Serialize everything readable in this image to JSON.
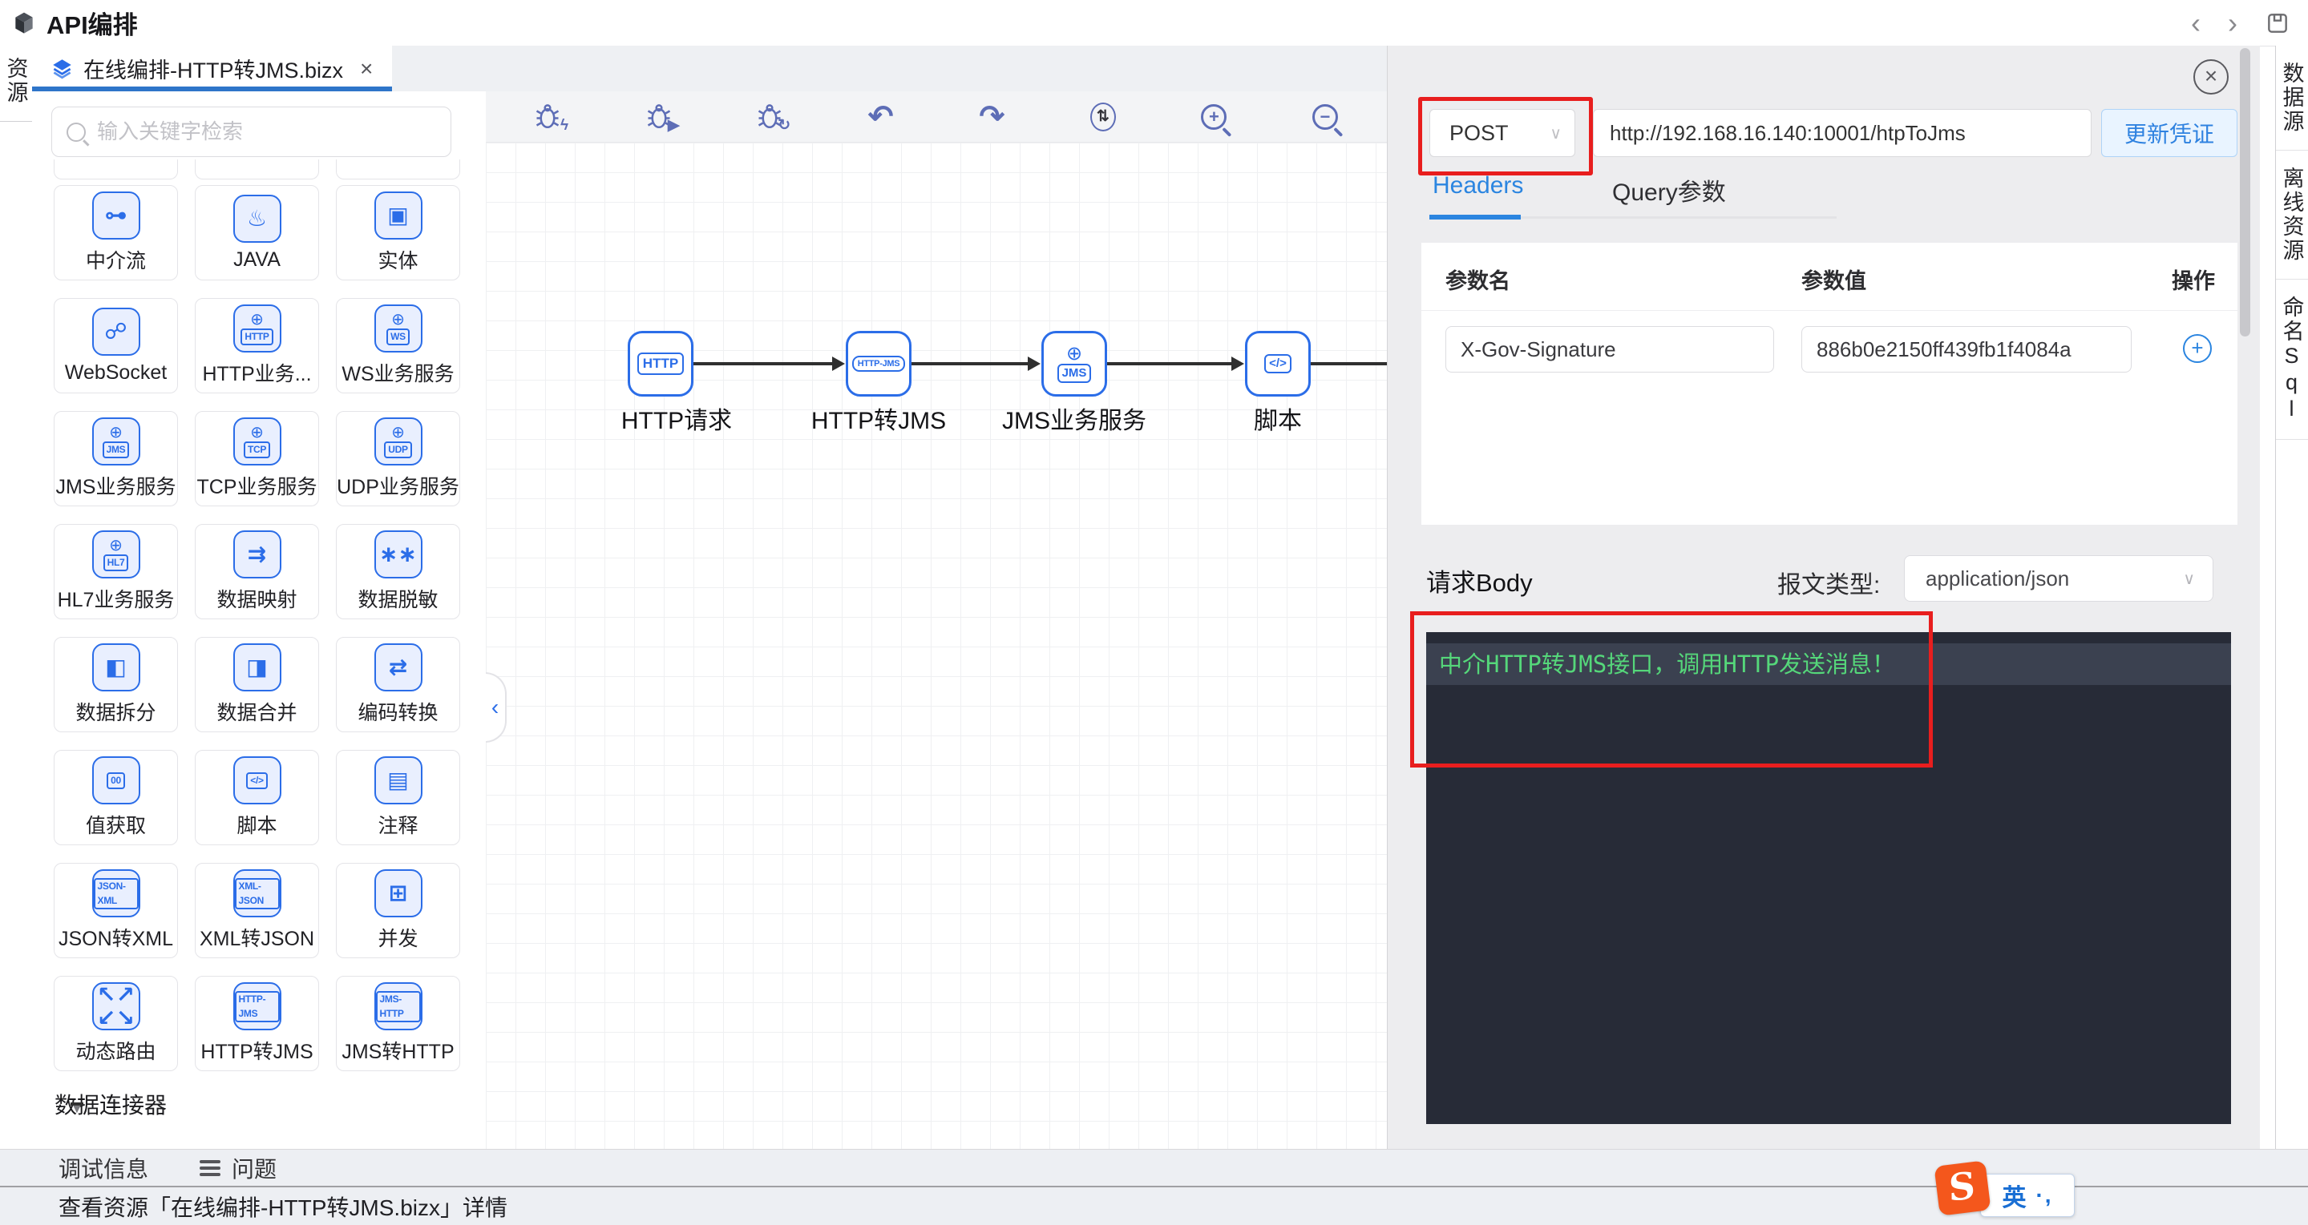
{
  "titlebar": {
    "title": "API编排",
    "back_glyph": "‹",
    "forward_glyph": "›"
  },
  "left_strip": {
    "resources_label": "资源"
  },
  "right_strip": {
    "items": [
      {
        "label": "数据源"
      },
      {
        "label": "离线资源"
      },
      {
        "label": "命名Sql"
      }
    ]
  },
  "tabbar": {
    "active_tab": {
      "title": "在线编排-HTTP转JMS.bizx",
      "close_glyph": "×"
    }
  },
  "palette": {
    "search_placeholder": "输入关键字检索",
    "cards": [
      {
        "label": "中介流",
        "glyph": "⊶"
      },
      {
        "label": "JAVA",
        "glyph": "♨"
      },
      {
        "label": "实体",
        "glyph": "▣"
      },
      {
        "label": "WebSocket",
        "glyph": "☍"
      },
      {
        "label": "HTTP业务...",
        "globe": "⊕",
        "badge": "HTTP"
      },
      {
        "label": "WS业务服务",
        "globe": "⊕",
        "badge": "WS"
      },
      {
        "label": "JMS业务服务",
        "globe": "⊕",
        "badge": "JMS"
      },
      {
        "label": "TCP业务服务",
        "globe": "⊕",
        "badge": "TCP"
      },
      {
        "label": "UDP业务服务",
        "globe": "⊕",
        "badge": "UDP"
      },
      {
        "label": "HL7业务服务",
        "globe": "⊕",
        "badge": "HL7"
      },
      {
        "label": "数据映射",
        "glyph": "⇉"
      },
      {
        "label": "数据脱敏",
        "glyph": "∗∗"
      },
      {
        "label": "数据拆分",
        "glyph": "◧"
      },
      {
        "label": "数据合并",
        "glyph": "◨"
      },
      {
        "label": "编码转换",
        "glyph": "⇄"
      },
      {
        "label": "值获取",
        "badge": "00"
      },
      {
        "label": "脚本",
        "badge": "</>"
      },
      {
        "label": "注释",
        "glyph": "▤"
      },
      {
        "label": "JSON转XML",
        "badge": "JSON-XML"
      },
      {
        "label": "XML转JSON",
        "badge": "XML-JSON"
      },
      {
        "label": "并发",
        "glyph": "⊞"
      },
      {
        "label": "动态路由",
        "glyph": "↖↗\n↙↘"
      },
      {
        "label": "HTTP转JMS",
        "badge": "HTTP-JMS"
      },
      {
        "label": "JMS转HTTP",
        "badge": "JMS-HTTP"
      }
    ],
    "footer": {
      "arrow_glyph": "▼",
      "label": "数据连接器"
    }
  },
  "canvas": {
    "toolbar": {
      "debug_flash_overlay": "ϟ",
      "debug_run_overlay": "▶",
      "debug_refresh_overlay": "↻",
      "undo_glyph": "↶",
      "redo_glyph": "↷",
      "swap_glyph": "⇅",
      "zoom_in_glyph": "+",
      "zoom_out_glyph": "−"
    },
    "flow": {
      "nodes": [
        {
          "label": "HTTP请求",
          "badge": "HTTP"
        },
        {
          "label": "HTTP转JMS",
          "badge": "HTTP-JMS"
        },
        {
          "label": "JMS业务服务",
          "globe": "⊕",
          "badge": "JMS"
        },
        {
          "label": "脚本",
          "badge": "</>"
        }
      ]
    },
    "collapse_glyph": "‹"
  },
  "inspector": {
    "close_glyph": "×",
    "request": {
      "method": "POST",
      "chevron": "∨",
      "url": "http://192.168.16.140:10001/htpToJms",
      "update_button": "更新凭证"
    },
    "tabs": [
      {
        "label": "Headers"
      },
      {
        "label": "Query参数"
      }
    ],
    "params": {
      "col_name": "参数名",
      "col_value": "参数值",
      "col_action": "操作",
      "row": {
        "name": "X-Gov-Signature",
        "value": "886b0e2150ff439fb1f4084a"
      },
      "add_glyph": "+"
    },
    "body": {
      "label": "请求Body",
      "content_type_label": "报文类型:",
      "content_type": "application/json",
      "chevron": "∨",
      "editor_text": "中介HTTP转JMS接口，调用HTTP发送消息！"
    }
  },
  "bottom_bar": {
    "debug_tab": "调试信息",
    "problems_tab": "问题"
  },
  "status_bar": {
    "text": "查看资源「在线编排-HTTP转JMS.bizx」详情"
  },
  "ime": {
    "logo_letter": "S",
    "mode": "英",
    "punct": "·,"
  },
  "colors": {
    "accent": "#2b6de8",
    "tab_underline": "#2e75c9",
    "headers_active": "#2b85e0",
    "annotation": "#e81e1e",
    "editor_green": "#55d77a",
    "editor_bg": "#272b37",
    "toolbar_icon": "#5d6db6"
  }
}
